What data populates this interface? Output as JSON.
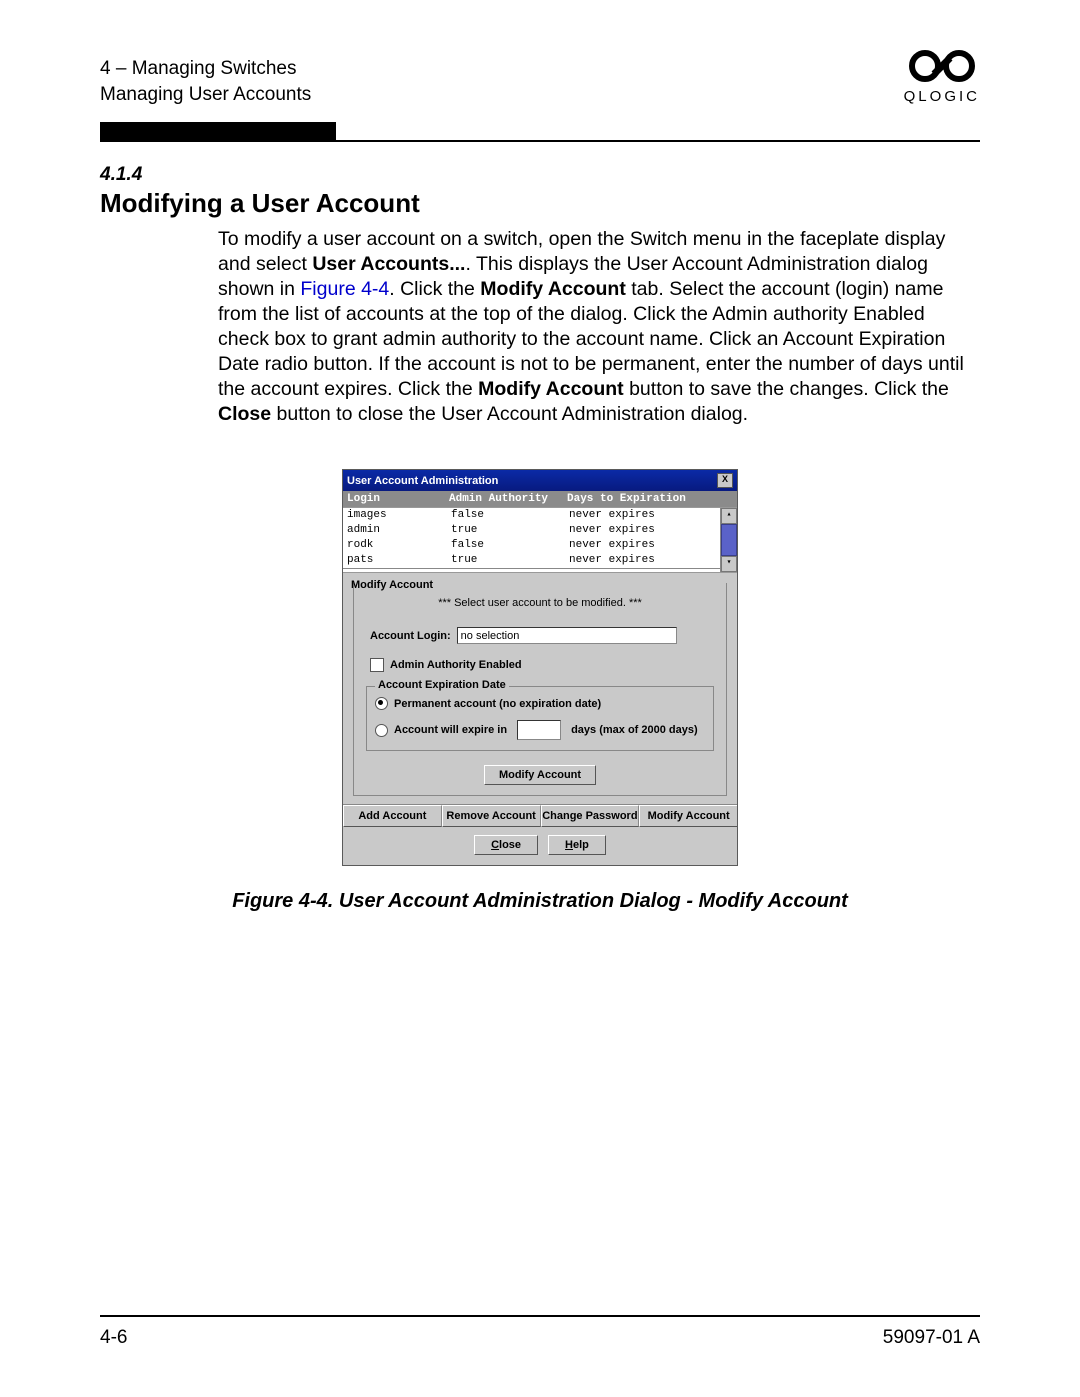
{
  "header": {
    "chapter_line": "4 – Managing Switches",
    "section_line": "Managing User Accounts",
    "logo_text": "QLOGIC"
  },
  "section": {
    "number": "4.1.4",
    "title": "Modifying a User Account"
  },
  "body": {
    "p1a": "To modify a user account on a switch, open the Switch menu in the faceplate display and select ",
    "p1b_bold": "User Accounts...",
    "p1c": ". This displays the User Account Administration dialog shown in ",
    "fig_link": "Figure 4-4",
    "p1d": ". Click the ",
    "p1e_bold": "Modify Account",
    "p1f": " tab. Select the account (login) name from the list of accounts at the top of the dialog. Click the Admin authority Enabled check box to grant admin authority to the account name. Click an Account Expiration Date radio button. If the account is not to be permanent, enter the number of days until the account expires. Click the ",
    "p1g_bold": "Modify Account",
    "p1h": " button to save the changes. Click the ",
    "p1i_bold": "Close",
    "p1j": " button to close the User Account Administration dialog."
  },
  "dialog": {
    "title": "User Account Administration",
    "close_x": "X",
    "columns": {
      "login": "Login",
      "auth": "Admin Authority",
      "exp": "Days to Expiration"
    },
    "rows": [
      {
        "login": "images",
        "auth": "false",
        "exp": "never expires"
      },
      {
        "login": "admin",
        "auth": "true",
        "exp": "never expires"
      },
      {
        "login": "rodk",
        "auth": "false",
        "exp": "never expires"
      },
      {
        "login": "pats",
        "auth": "true",
        "exp": "never expires"
      }
    ],
    "scroll_up": "▴",
    "scroll_down": "▾",
    "modify": {
      "panel_label": "Modify Account",
      "note": "*** Select user account to be modified. ***",
      "account_login_label": "Account Login:",
      "account_login_value": "no selection",
      "admin_check_label": "Admin Authority Enabled",
      "exp_legend": "Account Expiration Date",
      "radio_perm": "Permanent account (no expiration date)",
      "radio_exp_a": "Account will expire in",
      "radio_exp_b": "days (max of 2000 days)",
      "modify_btn": "Modify Account"
    },
    "tabs": {
      "add": "Add Account",
      "remove": "Remove Account",
      "change": "Change Password",
      "modify": "Modify Account"
    },
    "bottom": {
      "close_u": "C",
      "close_rest": "lose",
      "help_u": "H",
      "help_rest": "elp"
    }
  },
  "figure_caption": "Figure 4-4.  User Account Administration Dialog - Modify Account",
  "footer": {
    "page": "4-6",
    "doc": "59097-01 A"
  }
}
